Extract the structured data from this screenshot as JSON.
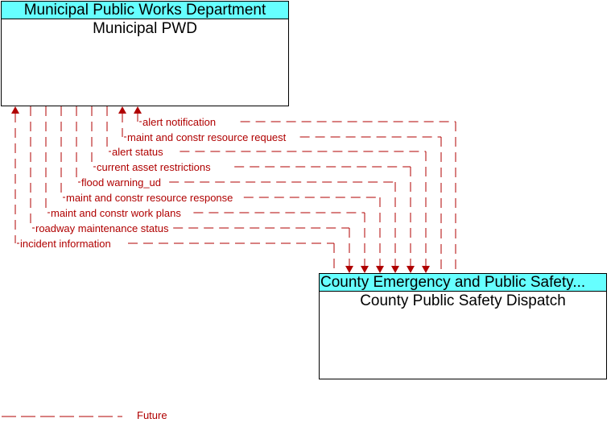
{
  "colors": {
    "header_fill": "#66ffff",
    "flow": "#b00000",
    "border": "#000000"
  },
  "elements": {
    "top": {
      "header": "Municipal Public Works Department",
      "name": "Municipal PWD"
    },
    "bottom": {
      "header": "County Emergency and Public Safety...",
      "name": "County Public Safety Dispatch"
    }
  },
  "flows": [
    {
      "label": "alert notification",
      "direction": "to-top",
      "status": "Future"
    },
    {
      "label": "maint and constr resource request",
      "direction": "to-top",
      "status": "Future"
    },
    {
      "label": "alert status",
      "direction": "to-bottom",
      "status": "Future"
    },
    {
      "label": "current asset restrictions",
      "direction": "to-bottom",
      "status": "Future"
    },
    {
      "label": "flood warning_ud",
      "direction": "to-bottom",
      "status": "Future"
    },
    {
      "label": "maint and constr resource response",
      "direction": "to-bottom",
      "status": "Future"
    },
    {
      "label": "maint and constr work plans",
      "direction": "to-bottom",
      "status": "Future"
    },
    {
      "label": "roadway maintenance status",
      "direction": "to-bottom",
      "status": "Future"
    },
    {
      "label": "incident information",
      "direction": "to-top",
      "status": "Future"
    }
  ],
  "legend": {
    "label": "Future"
  }
}
